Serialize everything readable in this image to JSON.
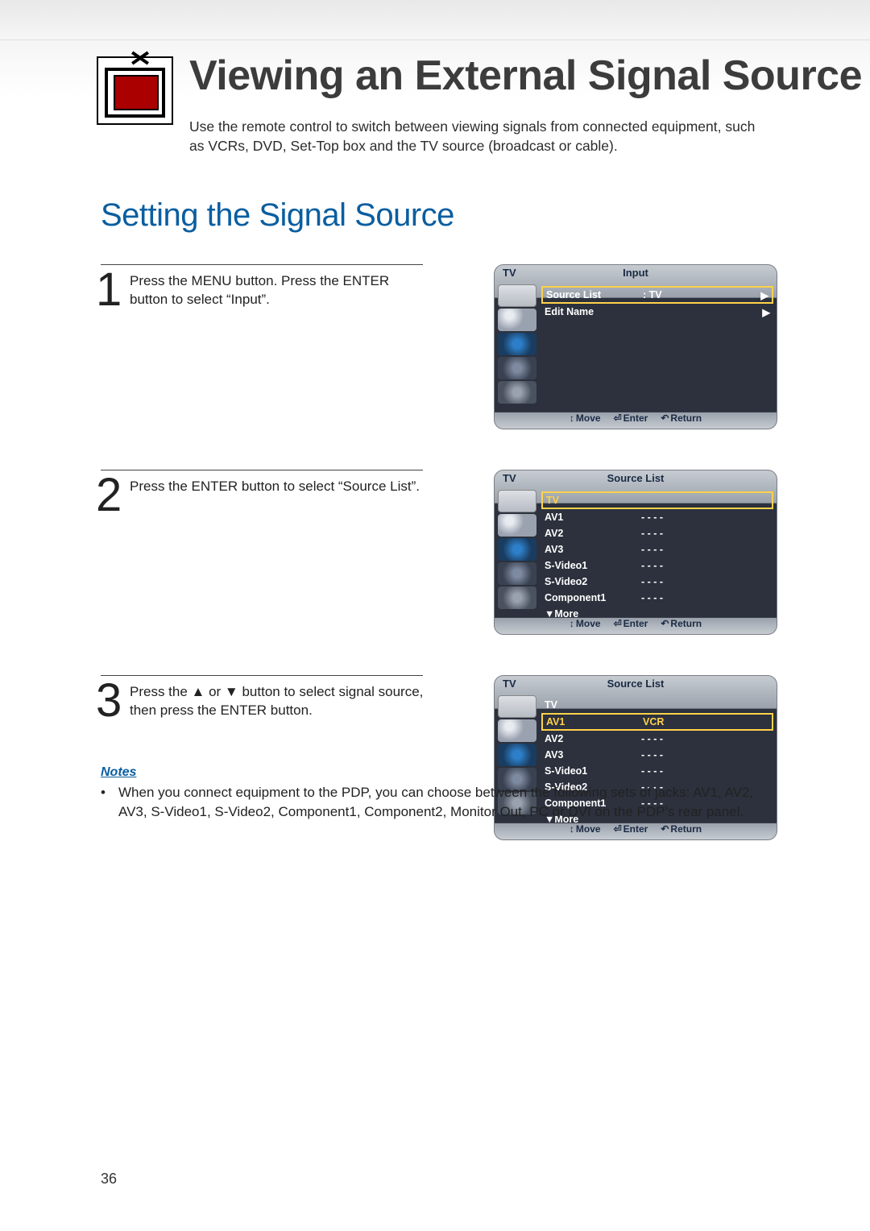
{
  "page_number": "36",
  "header": {
    "title": "Viewing an External Signal Source",
    "intro": "Use the remote control to switch between viewing signals from connected equipment, such as VCRs, DVD, Set-Top box and the TV source (broadcast or cable)."
  },
  "section_title": "Setting the Signal Source",
  "steps": [
    {
      "num": "1",
      "desc": "Press the MENU button. Press the ENTER button to select “Input”.",
      "osd": {
        "corner": "TV",
        "title": "Input",
        "rows_input": [
          {
            "label": "Source List",
            "value": ":  TV",
            "arrow": "▶",
            "selected": true,
            "yellow": false
          },
          {
            "label": "Edit Name",
            "value": "",
            "arrow": "▶",
            "selected": false,
            "yellow": false
          }
        ],
        "footer": {
          "move": "Move",
          "enter": "Enter",
          "return": "Return"
        }
      }
    },
    {
      "num": "2",
      "desc": "Press the ENTER button to select “Source List”.",
      "osd": {
        "corner": "TV",
        "title": "Source List",
        "rows_source": [
          {
            "label": "TV",
            "value": "",
            "selected": true,
            "yellow": true
          },
          {
            "label": "AV1",
            "value": "- - - -"
          },
          {
            "label": "AV2",
            "value": "- - - -"
          },
          {
            "label": "AV3",
            "value": "- - - -"
          },
          {
            "label": "S-Video1",
            "value": "- - - -"
          },
          {
            "label": "S-Video2",
            "value": "- - - -"
          },
          {
            "label": "Component1",
            "value": "- - - -"
          },
          {
            "label": "▼More",
            "value": ""
          }
        ],
        "footer": {
          "move": "Move",
          "enter": "Enter",
          "return": "Return"
        }
      }
    },
    {
      "num": "3",
      "desc": "Press the ▲ or ▼ button to select signal source, then press the ENTER button.",
      "osd": {
        "corner": "TV",
        "title": "Source List",
        "rows_source": [
          {
            "label": "TV",
            "value": ""
          },
          {
            "label": "AV1",
            "value": "VCR",
            "selected": true,
            "yellow": true
          },
          {
            "label": "AV2",
            "value": "- - - -"
          },
          {
            "label": "AV3",
            "value": "- - - -"
          },
          {
            "label": "S-Video1",
            "value": "- - - -"
          },
          {
            "label": "S-Video2",
            "value": "- - - -"
          },
          {
            "label": "Component1",
            "value": "- - - -"
          },
          {
            "label": "▼More",
            "value": ""
          }
        ],
        "footer": {
          "move": "Move",
          "enter": "Enter",
          "return": "Return"
        }
      }
    }
  ],
  "notes": {
    "heading": "Notes",
    "body": "When you connect equipment to the PDP, you can choose between the following sets of jacks: AV1, AV2, AV3, S-Video1, S-Video2, Component1, Component2, Monitor Out, PC or DVI on the PDP's rear panel."
  },
  "footer_icons": {
    "move": "↕",
    "enter": "⏎",
    "return": "↶"
  }
}
